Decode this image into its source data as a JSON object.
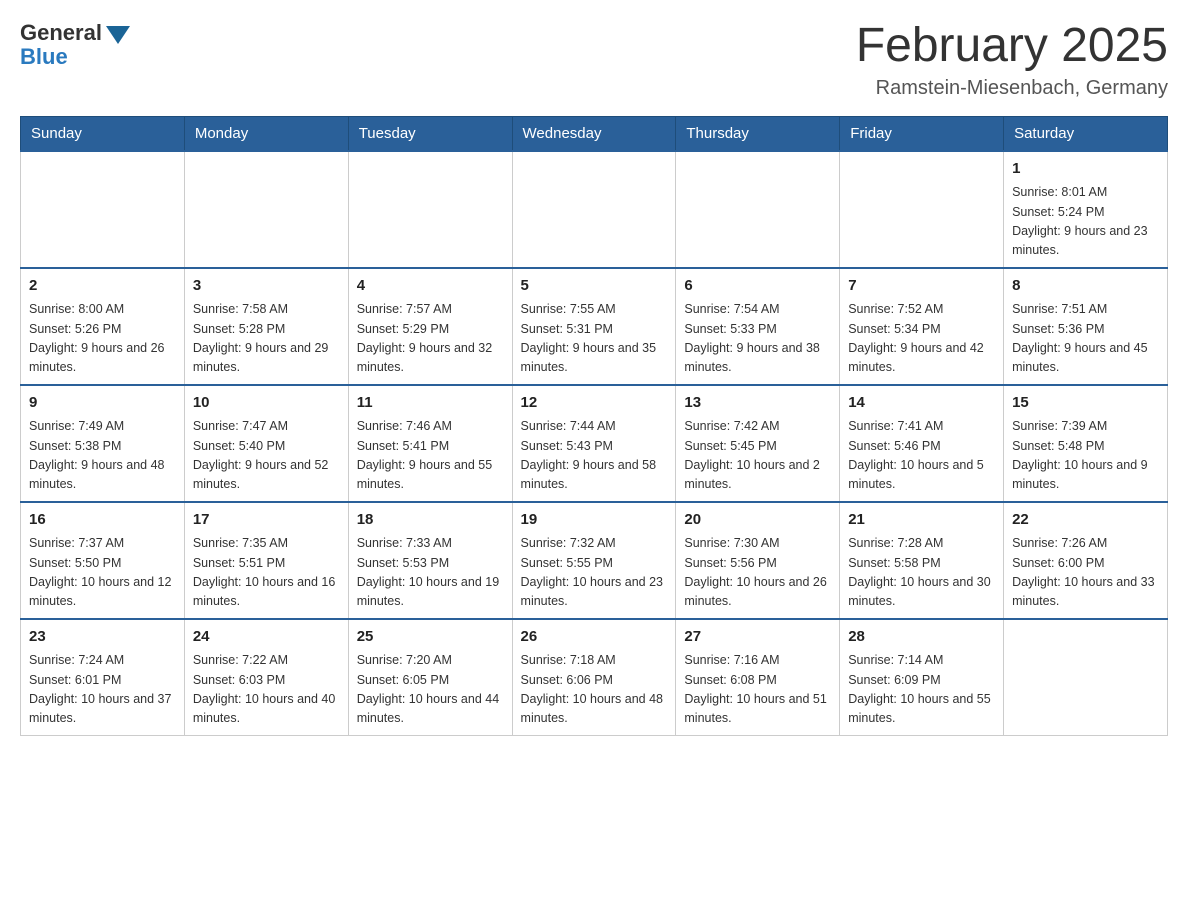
{
  "header": {
    "logo_general": "General",
    "logo_blue": "Blue",
    "title": "February 2025",
    "location": "Ramstein-Miesenbach, Germany"
  },
  "weekdays": [
    "Sunday",
    "Monday",
    "Tuesday",
    "Wednesday",
    "Thursday",
    "Friday",
    "Saturday"
  ],
  "weeks": [
    [
      {
        "day": "",
        "info": ""
      },
      {
        "day": "",
        "info": ""
      },
      {
        "day": "",
        "info": ""
      },
      {
        "day": "",
        "info": ""
      },
      {
        "day": "",
        "info": ""
      },
      {
        "day": "",
        "info": ""
      },
      {
        "day": "1",
        "info": "Sunrise: 8:01 AM\nSunset: 5:24 PM\nDaylight: 9 hours and 23 minutes."
      }
    ],
    [
      {
        "day": "2",
        "info": "Sunrise: 8:00 AM\nSunset: 5:26 PM\nDaylight: 9 hours and 26 minutes."
      },
      {
        "day": "3",
        "info": "Sunrise: 7:58 AM\nSunset: 5:28 PM\nDaylight: 9 hours and 29 minutes."
      },
      {
        "day": "4",
        "info": "Sunrise: 7:57 AM\nSunset: 5:29 PM\nDaylight: 9 hours and 32 minutes."
      },
      {
        "day": "5",
        "info": "Sunrise: 7:55 AM\nSunset: 5:31 PM\nDaylight: 9 hours and 35 minutes."
      },
      {
        "day": "6",
        "info": "Sunrise: 7:54 AM\nSunset: 5:33 PM\nDaylight: 9 hours and 38 minutes."
      },
      {
        "day": "7",
        "info": "Sunrise: 7:52 AM\nSunset: 5:34 PM\nDaylight: 9 hours and 42 minutes."
      },
      {
        "day": "8",
        "info": "Sunrise: 7:51 AM\nSunset: 5:36 PM\nDaylight: 9 hours and 45 minutes."
      }
    ],
    [
      {
        "day": "9",
        "info": "Sunrise: 7:49 AM\nSunset: 5:38 PM\nDaylight: 9 hours and 48 minutes."
      },
      {
        "day": "10",
        "info": "Sunrise: 7:47 AM\nSunset: 5:40 PM\nDaylight: 9 hours and 52 minutes."
      },
      {
        "day": "11",
        "info": "Sunrise: 7:46 AM\nSunset: 5:41 PM\nDaylight: 9 hours and 55 minutes."
      },
      {
        "day": "12",
        "info": "Sunrise: 7:44 AM\nSunset: 5:43 PM\nDaylight: 9 hours and 58 minutes."
      },
      {
        "day": "13",
        "info": "Sunrise: 7:42 AM\nSunset: 5:45 PM\nDaylight: 10 hours and 2 minutes."
      },
      {
        "day": "14",
        "info": "Sunrise: 7:41 AM\nSunset: 5:46 PM\nDaylight: 10 hours and 5 minutes."
      },
      {
        "day": "15",
        "info": "Sunrise: 7:39 AM\nSunset: 5:48 PM\nDaylight: 10 hours and 9 minutes."
      }
    ],
    [
      {
        "day": "16",
        "info": "Sunrise: 7:37 AM\nSunset: 5:50 PM\nDaylight: 10 hours and 12 minutes."
      },
      {
        "day": "17",
        "info": "Sunrise: 7:35 AM\nSunset: 5:51 PM\nDaylight: 10 hours and 16 minutes."
      },
      {
        "day": "18",
        "info": "Sunrise: 7:33 AM\nSunset: 5:53 PM\nDaylight: 10 hours and 19 minutes."
      },
      {
        "day": "19",
        "info": "Sunrise: 7:32 AM\nSunset: 5:55 PM\nDaylight: 10 hours and 23 minutes."
      },
      {
        "day": "20",
        "info": "Sunrise: 7:30 AM\nSunset: 5:56 PM\nDaylight: 10 hours and 26 minutes."
      },
      {
        "day": "21",
        "info": "Sunrise: 7:28 AM\nSunset: 5:58 PM\nDaylight: 10 hours and 30 minutes."
      },
      {
        "day": "22",
        "info": "Sunrise: 7:26 AM\nSunset: 6:00 PM\nDaylight: 10 hours and 33 minutes."
      }
    ],
    [
      {
        "day": "23",
        "info": "Sunrise: 7:24 AM\nSunset: 6:01 PM\nDaylight: 10 hours and 37 minutes."
      },
      {
        "day": "24",
        "info": "Sunrise: 7:22 AM\nSunset: 6:03 PM\nDaylight: 10 hours and 40 minutes."
      },
      {
        "day": "25",
        "info": "Sunrise: 7:20 AM\nSunset: 6:05 PM\nDaylight: 10 hours and 44 minutes."
      },
      {
        "day": "26",
        "info": "Sunrise: 7:18 AM\nSunset: 6:06 PM\nDaylight: 10 hours and 48 minutes."
      },
      {
        "day": "27",
        "info": "Sunrise: 7:16 AM\nSunset: 6:08 PM\nDaylight: 10 hours and 51 minutes."
      },
      {
        "day": "28",
        "info": "Sunrise: 7:14 AM\nSunset: 6:09 PM\nDaylight: 10 hours and 55 minutes."
      },
      {
        "day": "",
        "info": ""
      }
    ]
  ]
}
